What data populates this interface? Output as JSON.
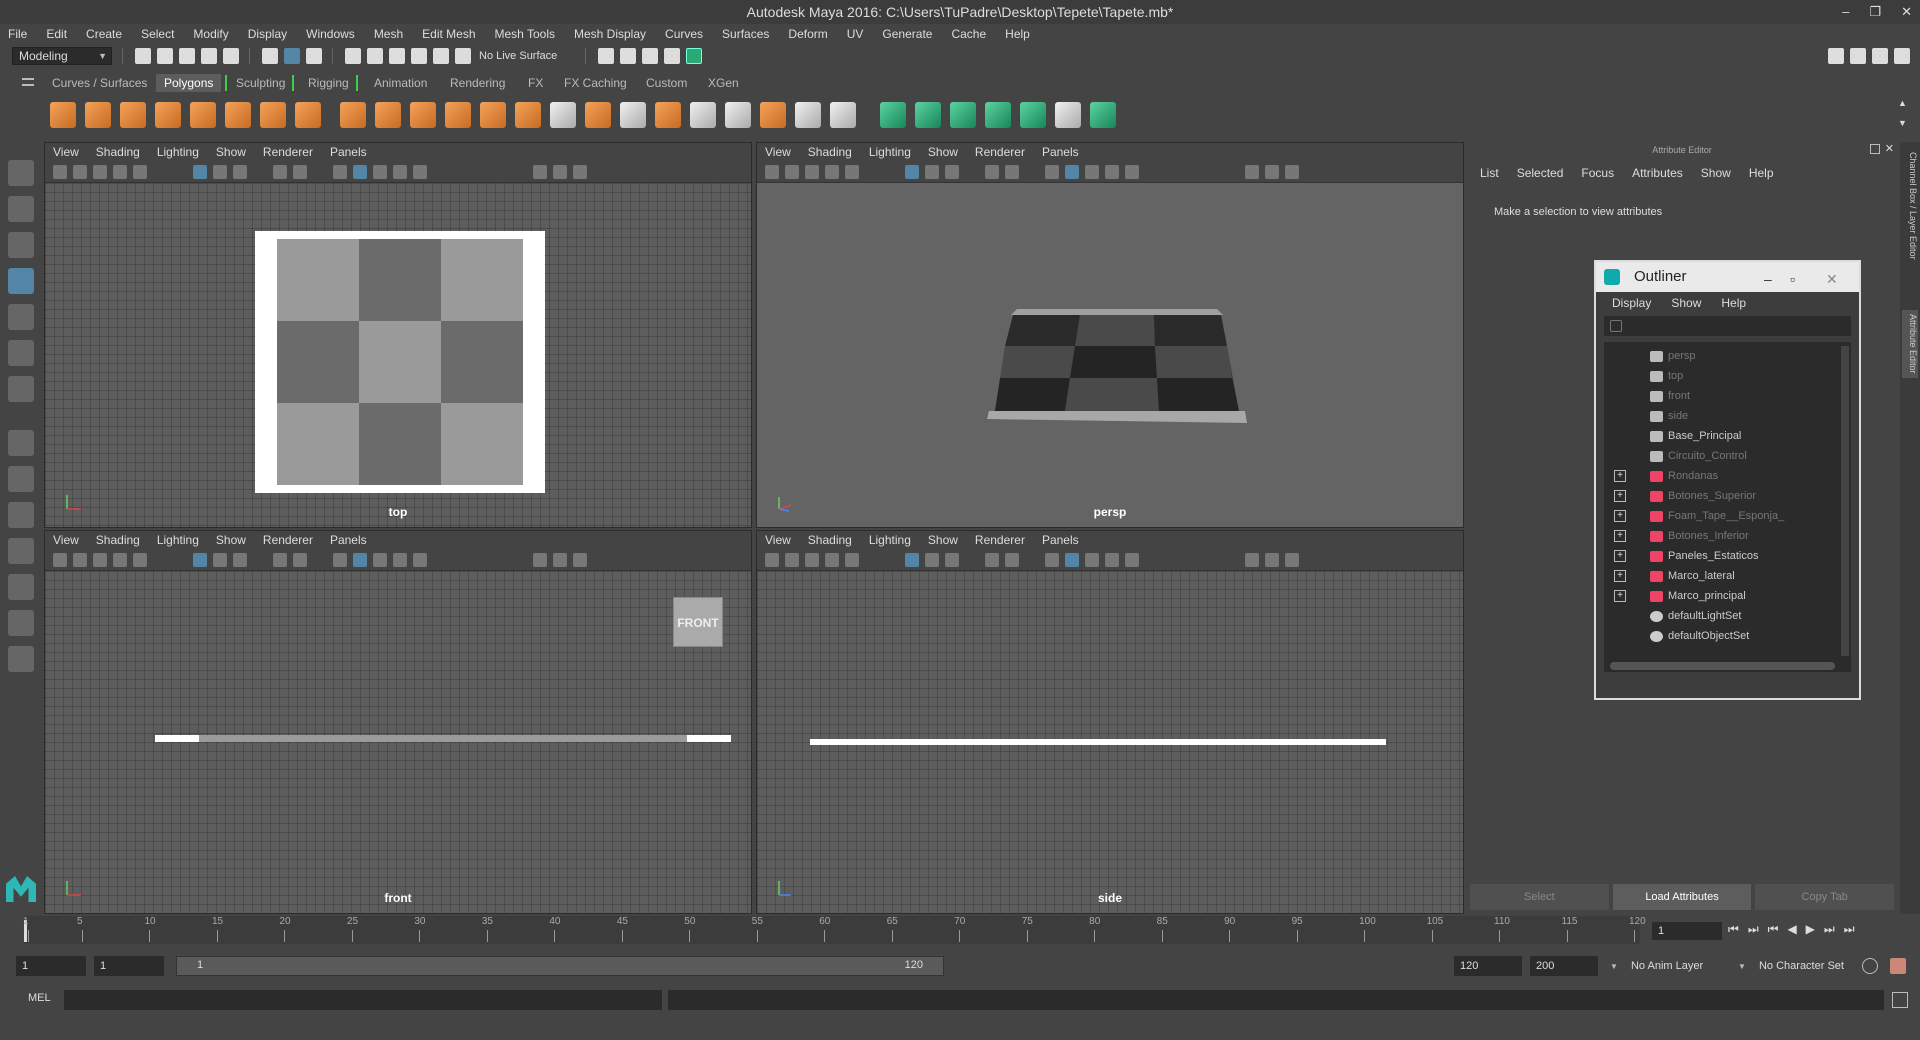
{
  "window": {
    "title": "Autodesk Maya 2016: C:\\Users\\TuPadre\\Desktop\\Tepete\\Tapete.mb*",
    "minimize": "–",
    "restore": "❐",
    "close": "✕"
  },
  "menubar": [
    "File",
    "Edit",
    "Create",
    "Select",
    "Modify",
    "Display",
    "Windows",
    "Mesh",
    "Edit Mesh",
    "Mesh Tools",
    "Mesh Display",
    "Curves",
    "Surfaces",
    "Deform",
    "UV",
    "Generate",
    "Cache",
    "Help"
  ],
  "statusline": {
    "mode": "Modeling",
    "live_surface": "No Live Surface"
  },
  "shelf_tabs": [
    "Curves / Surfaces",
    "Polygons",
    "Sculpting",
    "Rigging",
    "Animation",
    "Rendering",
    "FX",
    "FX Caching",
    "Custom",
    "XGen"
  ],
  "shelf_active": "Polygons",
  "panel_menu": [
    "View",
    "Shading",
    "Lighting",
    "Show",
    "Renderer",
    "Panels"
  ],
  "viewports": {
    "top": "top",
    "persp": "persp",
    "front": "front",
    "side": "side",
    "front_cube": "FRONT"
  },
  "attribute_editor": {
    "header": "Attribute Editor",
    "menu": [
      "List",
      "Selected",
      "Focus",
      "Attributes",
      "Show",
      "Help"
    ],
    "message": "Make a selection to view attributes",
    "buttons": [
      "Select",
      "Load Attributes",
      "Copy Tab"
    ]
  },
  "side_tabs": [
    "Channel Box / Layer Editor",
    "Attribute Editor"
  ],
  "outliner": {
    "title": "Outliner",
    "menu": [
      "Display",
      "Show",
      "Help"
    ],
    "items": [
      {
        "label": "persp",
        "type": "camera",
        "dim": true,
        "expand": false
      },
      {
        "label": "top",
        "type": "camera",
        "dim": true,
        "expand": false
      },
      {
        "label": "front",
        "type": "camera",
        "dim": true,
        "expand": false
      },
      {
        "label": "side",
        "type": "camera",
        "dim": true,
        "expand": false
      },
      {
        "label": "Base_Principal",
        "type": "curve",
        "dim": false,
        "expand": false
      },
      {
        "label": "Circuito_Control",
        "type": "curve",
        "dim": true,
        "expand": false
      },
      {
        "label": "Rondanas",
        "type": "mesh",
        "dim": true,
        "expand": true
      },
      {
        "label": "Botones_Superior",
        "type": "mesh",
        "dim": true,
        "expand": true
      },
      {
        "label": "Foam_Tape__Esponja_",
        "type": "mesh",
        "dim": true,
        "expand": true
      },
      {
        "label": "Botones_Inferior",
        "type": "mesh",
        "dim": true,
        "expand": true
      },
      {
        "label": "Paneles_Estaticos",
        "type": "mesh",
        "dim": false,
        "expand": true
      },
      {
        "label": "Marco_lateral",
        "type": "mesh",
        "dim": false,
        "expand": true
      },
      {
        "label": "Marco_principal",
        "type": "mesh",
        "dim": false,
        "expand": true
      },
      {
        "label": "defaultLightSet",
        "type": "set",
        "dim": false,
        "expand": false
      },
      {
        "label": "defaultObjectSet",
        "type": "set",
        "dim": false,
        "expand": false
      }
    ]
  },
  "timeline": {
    "ticks": [
      1,
      5,
      10,
      15,
      20,
      25,
      30,
      35,
      40,
      45,
      50,
      55,
      60,
      65,
      70,
      75,
      80,
      85,
      90,
      95,
      100,
      105,
      110,
      115,
      120
    ],
    "current_frame": "1",
    "play_controls": [
      "⏮",
      "⏭",
      "⏮",
      "◀",
      "▶",
      "⏭",
      "⏭"
    ]
  },
  "range": {
    "start": "1",
    "start2": "1",
    "inner_start": "1",
    "inner_end": "120",
    "end": "120",
    "end2": "200",
    "anim_layer": "No Anim Layer",
    "char_set": "No Character Set"
  },
  "command": {
    "mel": "MEL"
  },
  "colors": {
    "accent_blue": "#5285a6",
    "shelf_orange": "#e08a3c",
    "shelf_green": "#2aa875"
  }
}
